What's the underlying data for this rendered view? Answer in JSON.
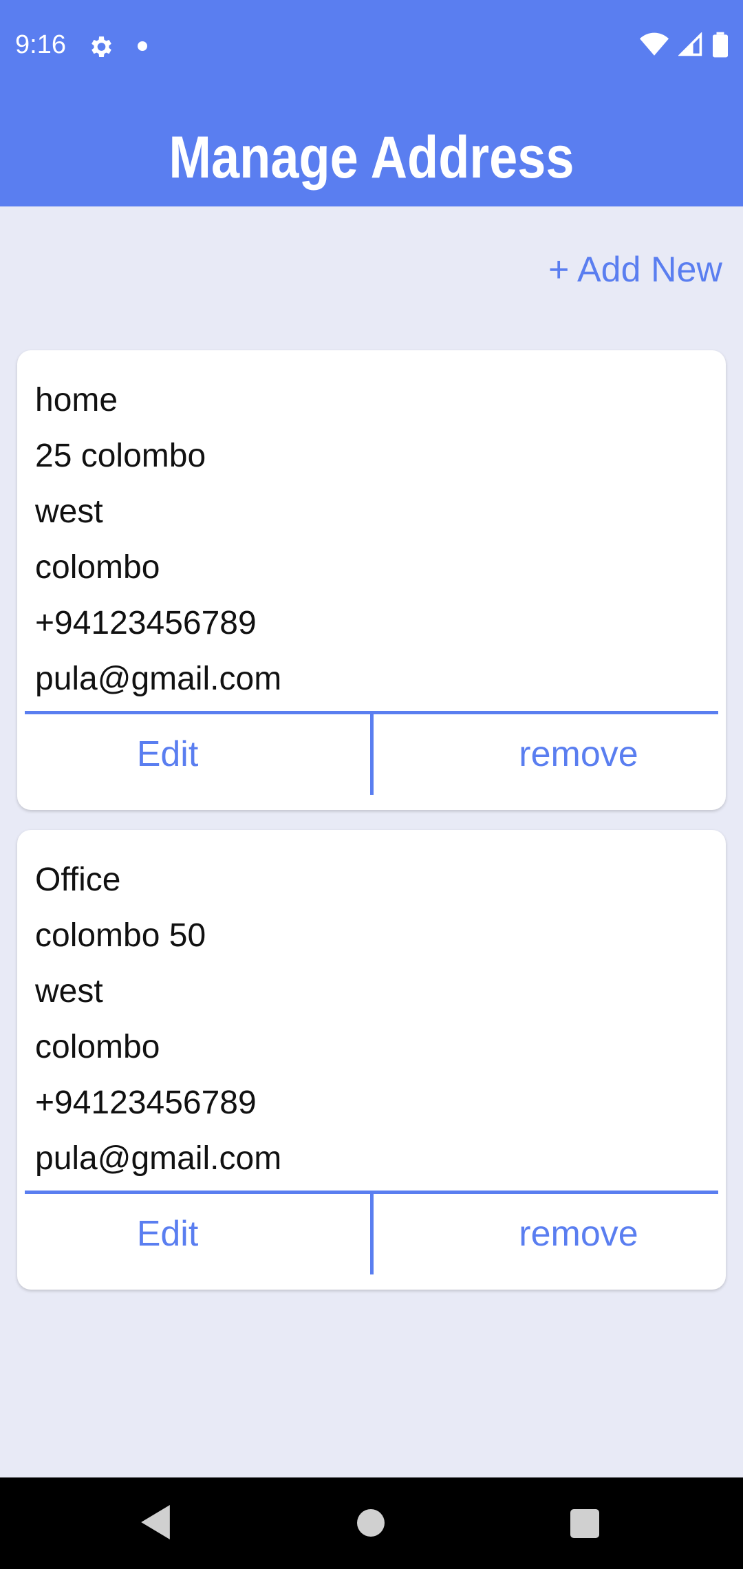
{
  "status_bar": {
    "time": "9:16",
    "icons": [
      "gear-icon",
      "dot-icon",
      "wifi-icon",
      "signal-icon",
      "battery-icon"
    ]
  },
  "header": {
    "title": "Manage Address"
  },
  "actions": {
    "add_new_label": "+ Add New"
  },
  "addresses": [
    {
      "lines": [
        "home",
        "25 colombo",
        "west",
        "colombo",
        "+94123456789",
        "pula@gmail.com"
      ],
      "edit_label": "Edit",
      "remove_label": "remove"
    },
    {
      "lines": [
        "Office",
        "colombo 50",
        "west",
        "colombo",
        "+94123456789",
        "pula@gmail.com"
      ],
      "edit_label": "Edit",
      "remove_label": "remove"
    }
  ],
  "colors": {
    "accent": "#5a7ef0",
    "background": "#e8eaf6",
    "card": "#ffffff"
  }
}
